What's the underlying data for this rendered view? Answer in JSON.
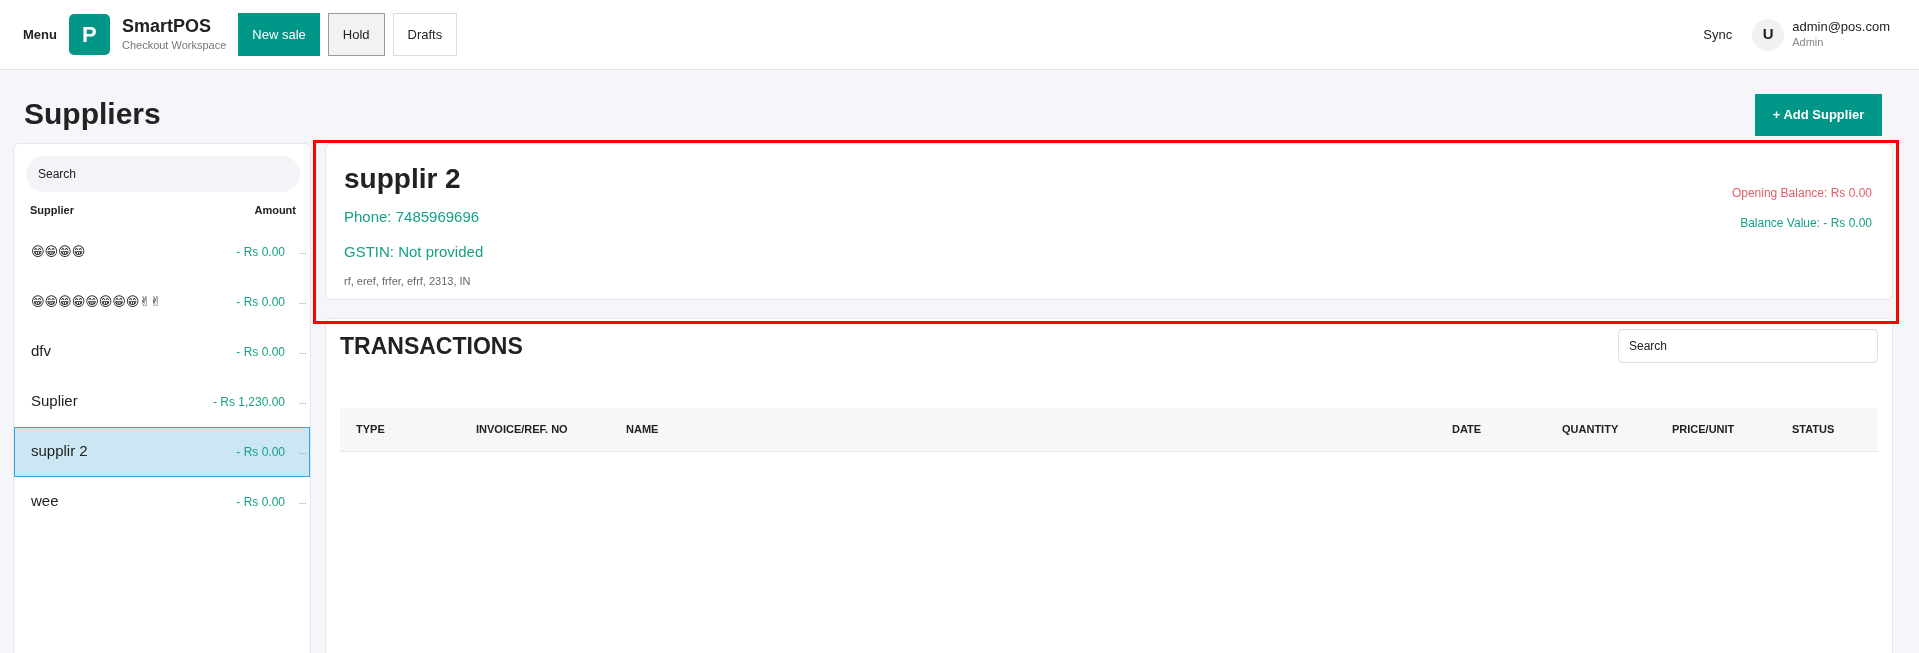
{
  "header": {
    "menu": "Menu",
    "logo_letter": "P",
    "app_name": "SmartPOS",
    "app_subtitle": "Checkout Workspace",
    "buttons": [
      {
        "label": "New sale",
        "kind": "primary"
      },
      {
        "label": "Hold",
        "kind": "pressed"
      },
      {
        "label": "Drafts",
        "kind": "plain"
      }
    ],
    "sync": "Sync",
    "user": {
      "initial": "U",
      "email": "admin@pos.com",
      "role": "Admin"
    }
  },
  "page_title": "Suppliers",
  "add_button": "+ Add Supplier",
  "sidebar": {
    "search": {
      "placeholder": "Search"
    },
    "columns": [
      "Supplier",
      "Amount"
    ],
    "items": [
      {
        "name": "😁😁😁😁",
        "amount": "- Rs 0.00",
        "more": "...",
        "selected": false,
        "kind": "emoji"
      },
      {
        "name": "😁😁😁😁😁😁😁😁✌✌",
        "amount": "- Rs 0.00",
        "more": "...",
        "selected": false,
        "kind": "emoji"
      },
      {
        "name": "dfv",
        "amount": "- Rs 0.00",
        "more": "...",
        "selected": false,
        "kind": "text"
      },
      {
        "name": "Suplier",
        "amount": "- Rs 1,230.00",
        "more": "...",
        "selected": false,
        "kind": "text"
      },
      {
        "name": "supplir 2",
        "amount": "- Rs 0.00",
        "more": "...",
        "selected": true,
        "kind": "text"
      },
      {
        "name": "wee",
        "amount": "- Rs 0.00",
        "more": "...",
        "selected": false,
        "kind": "text"
      }
    ]
  },
  "detail": {
    "name": "supplir 2",
    "phone": "Phone: 7485969696",
    "gstin": "GSTIN: Not provided",
    "address": "rf, eref, frfer, efrf, 2313, IN",
    "opening_balance": "Opening Balance: Rs 0.00",
    "balance_value": "Balance Value: - Rs 0.00"
  },
  "transactions": {
    "title": "TRANSACTIONS",
    "search": {
      "placeholder": "Search"
    },
    "columns": [
      "TYPE",
      "INVOICE/REF. NO",
      "NAME",
      "DATE",
      "QUANTITY",
      "PRICE/UNIT",
      "STATUS"
    ]
  }
}
